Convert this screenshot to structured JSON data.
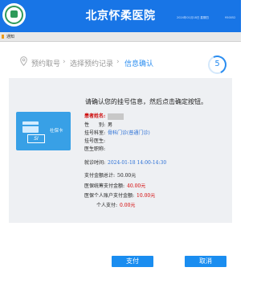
{
  "header": {
    "title": "北京怀柔医院",
    "info_left": "2024年01月18日 星期四",
    "info_right": "950052",
    "logo_icon": "hospital-logo-icon"
  },
  "notice": {
    "label": "通知"
  },
  "steps": [
    {
      "label": "预约取号",
      "active": false
    },
    {
      "label": "选择预约记录",
      "active": false
    },
    {
      "label": "信息确认",
      "active": true
    }
  ],
  "timer": {
    "value": "5"
  },
  "instruction": "请确认您的挂号信息，然后点击确定按钮。",
  "card": {
    "label": "社保卡",
    "si_text": "SI"
  },
  "patient": {
    "name_label": "患者姓名:",
    "gender_label": "性　　别:",
    "gender_value": "男",
    "dept_label": "挂号科室:",
    "dept_value": "骨科门诊(普通门诊)",
    "doctor_label": "挂号医生:",
    "doctor_title_label": "医生职称:",
    "time_label": "就诊时间:",
    "time_value": "2024-01-18 14:00-14:30"
  },
  "payment": {
    "total_label": "支付金额总计:",
    "total_value": "50.00元",
    "pool_label": "医保统筹支付金额:",
    "pool_value": "40.00元",
    "account_label": "医保个人账户支付金额:",
    "account_value": "10.00元",
    "self_label": "个人支付:",
    "self_value": "0.00元"
  },
  "buttons": {
    "pay": "支付",
    "cancel": "取消"
  },
  "colors": {
    "brand": "#1875e6",
    "accent": "#2a8df0",
    "button": "#1a8df0"
  }
}
